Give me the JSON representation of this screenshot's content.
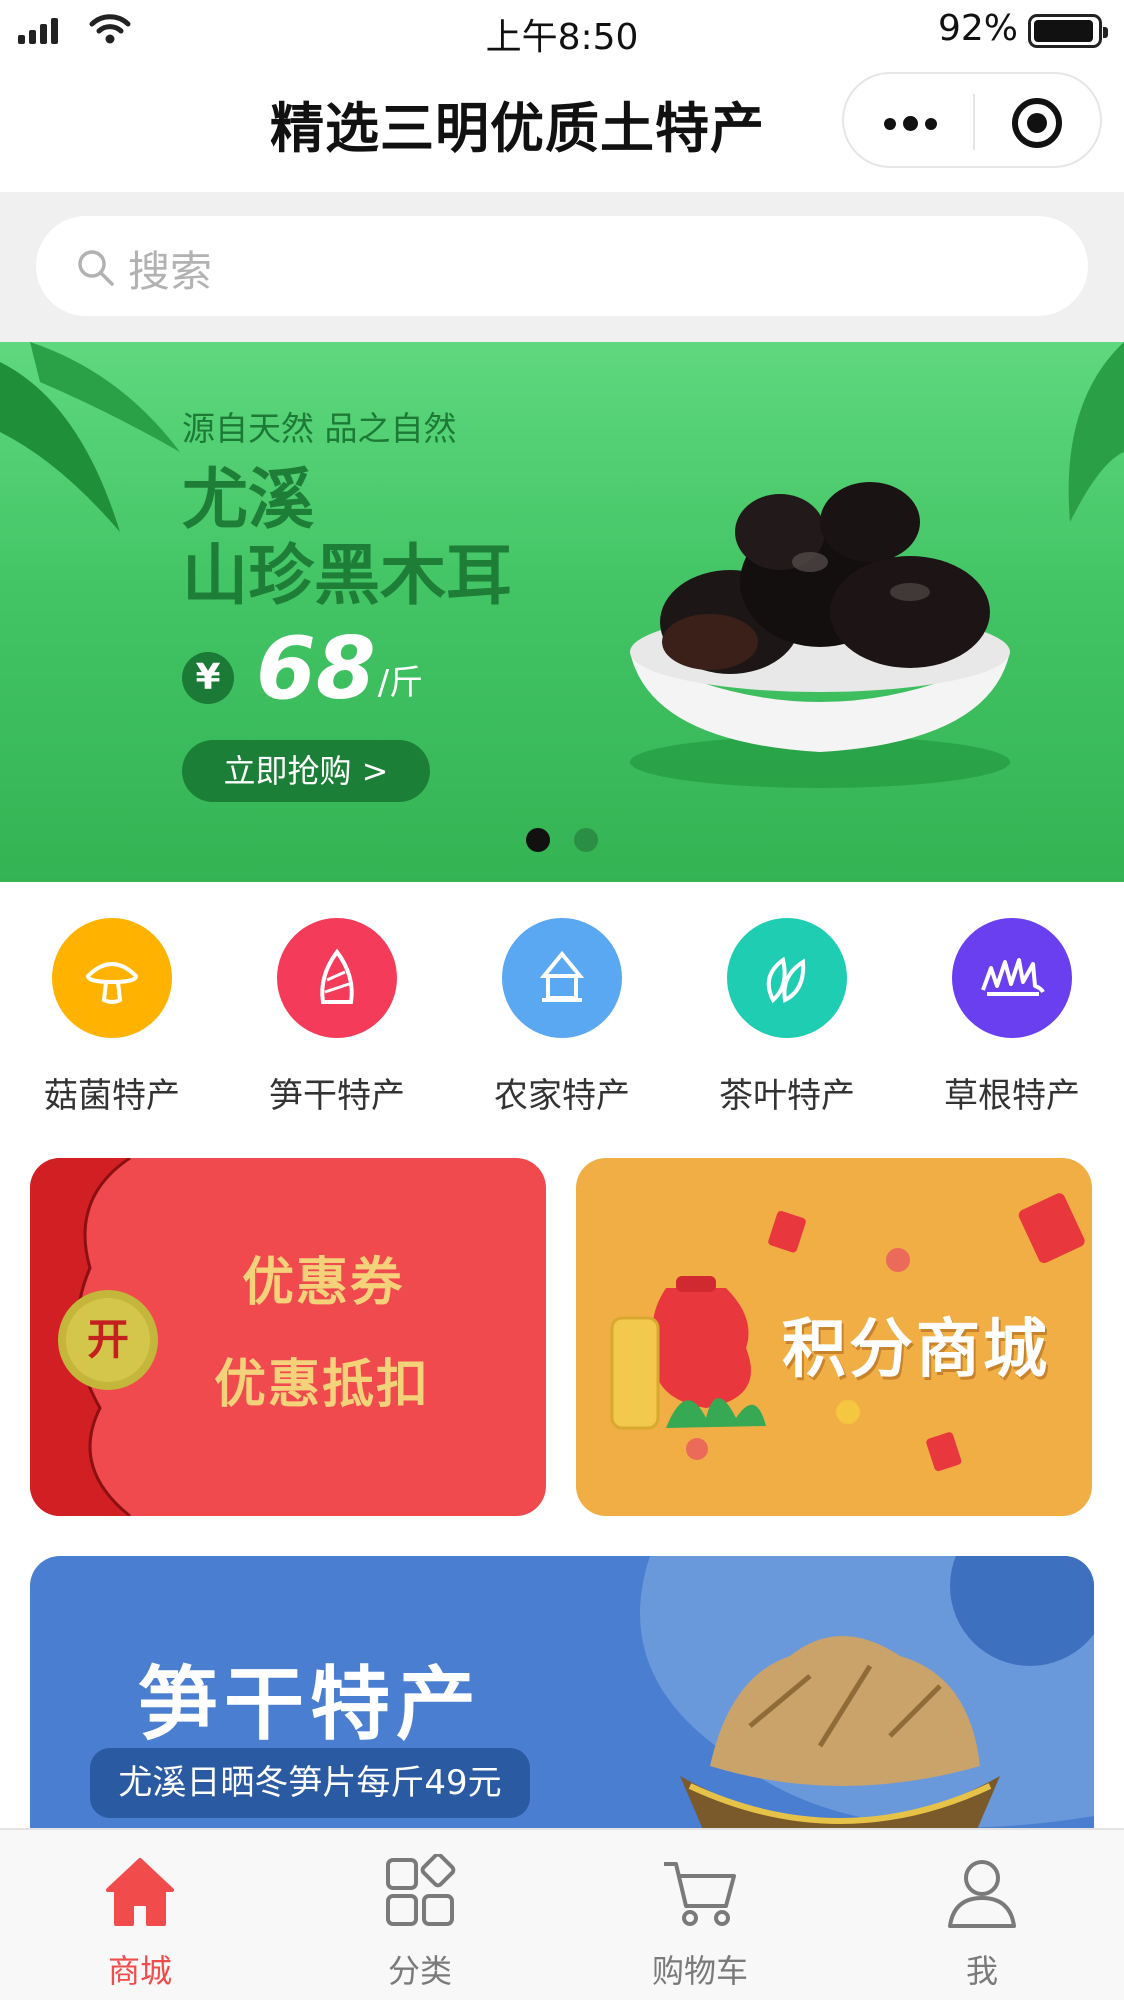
{
  "status_bar": {
    "time": "上午8:50",
    "battery": "92%"
  },
  "navbar": {
    "title": "精选三明优质土特产"
  },
  "search": {
    "placeholder": "搜索"
  },
  "banner": {
    "tagline": "源自天然 品之自然",
    "title_line1": "尤溪",
    "title_line2": "山珍黑木耳",
    "currency": "¥",
    "price": "68",
    "unit": "/斤",
    "button": "立即抢购 >",
    "active_slide": 1,
    "slide_count": 2
  },
  "categories": [
    {
      "label": "菇菌特产",
      "icon": "mushroom-icon",
      "color": "#ffb300"
    },
    {
      "label": "笋干特产",
      "icon": "bamboo-shoot-icon",
      "color": "#f43b5a"
    },
    {
      "label": "农家特产",
      "icon": "farmhouse-icon",
      "color": "#5aa8f2"
    },
    {
      "label": "茶叶特产",
      "icon": "tea-leaf-icon",
      "color": "#1fcdb2"
    },
    {
      "label": "草根特产",
      "icon": "grass-icon",
      "color": "#6a3ff0"
    }
  ],
  "promos": {
    "coupon": {
      "badge": "开",
      "line1": "优惠券",
      "line2": "优惠抵扣"
    },
    "points": {
      "title": "积分商城"
    }
  },
  "feature": {
    "title": "笋干特产",
    "subtitle": "尤溪日晒冬笋片每斤49元"
  },
  "tabbar": [
    {
      "label": "商城",
      "icon": "home-icon",
      "active": true
    },
    {
      "label": "分类",
      "icon": "category-icon",
      "active": false
    },
    {
      "label": "购物车",
      "icon": "cart-icon",
      "active": false
    },
    {
      "label": "我",
      "icon": "user-icon",
      "active": false
    }
  ],
  "colors": {
    "accent": "#f24b4b",
    "banner_green": "#43c565"
  }
}
